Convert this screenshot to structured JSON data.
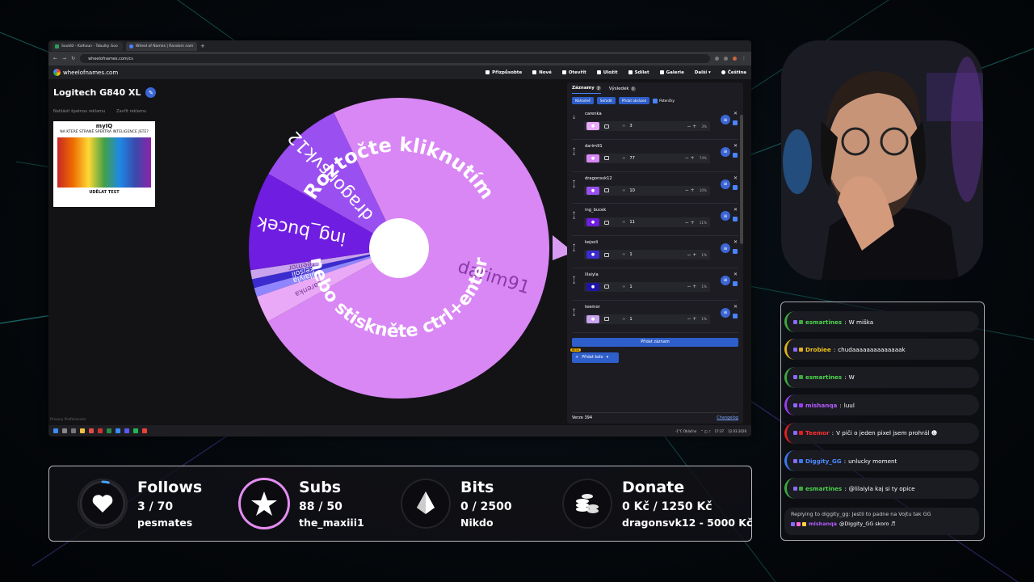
{
  "browser": {
    "tabs": [
      {
        "label": "Soutěž - Kalhoun - Tabulky Goo"
      },
      {
        "label": "Wheel of Names | Random nam"
      }
    ],
    "url": "wheelofnames.com/cs"
  },
  "app": {
    "logo": "wheelofnames.com",
    "menu": [
      "Přizpůsobte",
      "Nové",
      "Otevřít",
      "Uložit",
      "Sdílet",
      "Galerie",
      "Další",
      "Čeština"
    ]
  },
  "wheel": {
    "title": "Logitech G840 XL",
    "ad_links": [
      "Nahlásit špatnou reklamu",
      "Zavřít reklamu"
    ],
    "overlay_line1": "Roztočte kliknutím",
    "overlay_line2": "nebo stiskněte ctrl+enter",
    "slices": [
      {
        "name": "darim91",
        "weight": 77,
        "color": "#d987f5",
        "text": "#8a3aa8"
      },
      {
        "name": "carenka",
        "weight": 3,
        "color": "#e9a9f7",
        "text": "#7a3a98"
      },
      {
        "name": "lilaiyla",
        "weight": 1,
        "color": "#8f86ff",
        "text": "#ffffff"
      },
      {
        "name": "kejsoli",
        "weight": 1,
        "color": "#3a2ccf",
        "text": "#ffffff"
      },
      {
        "name": "teemor",
        "weight": 1,
        "color": "#c9a3ee",
        "text": "#6a3a98"
      },
      {
        "name": "ing_bucek",
        "weight": 11,
        "color": "#6f1de0",
        "text": "#ffffff"
      },
      {
        "name": "dragonsvk12",
        "weight": 10,
        "color": "#9a4ff0",
        "text": "#ffffff"
      }
    ]
  },
  "ad": {
    "brand": "myIQ",
    "question": "NA KTERÉ STRANĚ SPEKTRA INTELIGENCE JSTE?",
    "cta": "UDĚLAT TEST"
  },
  "privacy": "Privacy Preferences",
  "sidebar": {
    "tabs": [
      {
        "label": "Záznamy",
        "count": "7"
      },
      {
        "label": "Výsledek",
        "count": "0"
      }
    ],
    "tools": [
      "Náhodně",
      "Seřadit",
      "Přidat obrázek"
    ],
    "weights_label": "Potenčky",
    "entries": [
      {
        "name": "carenka",
        "weight": "3",
        "pct": "3%",
        "color": "#e9a9f7"
      },
      {
        "name": "darim91",
        "weight": "77",
        "pct": "74%",
        "color": "#d987f5"
      },
      {
        "name": "dragonsvk12",
        "weight": "10",
        "pct": "10%",
        "color": "#9a4ff0"
      },
      {
        "name": "ing_bucek",
        "weight": "11",
        "pct": "11%",
        "color": "#6f1de0"
      },
      {
        "name": "kejsoli",
        "weight": "1",
        "pct": "1%",
        "color": "#3a2ccf"
      },
      {
        "name": "lilaiyla",
        "weight": "1",
        "pct": "1%",
        "color": "#1e15a8"
      },
      {
        "name": "teemor",
        "weight": "1",
        "pct": "1%",
        "color": "#c9a3ee"
      }
    ],
    "add_entry": "Přidat záznam",
    "add_wheel": "Přidat kolo",
    "beta": "BETA",
    "version": "Verze 394",
    "changelog": "Changelog"
  },
  "taskbar": {
    "weather": "-1°C Oblačno",
    "time": "17:37",
    "date": "12.03.2026"
  },
  "chat": {
    "messages": [
      {
        "user": "esmartines",
        "text": "W miška",
        "user_color": "#4cd34c",
        "border": "#3ea83e"
      },
      {
        "user": "Drobiee",
        "text": "chudaaaaaaaaaaaaaak",
        "user_color": "#f0c419",
        "border": "#e0b020"
      },
      {
        "user": "esmartines",
        "text": "W",
        "user_color": "#4cd34c",
        "border": "#3ea83e"
      },
      {
        "user": "mishanqa",
        "text": "luul",
        "user_color": "#b45cff",
        "border": "#9b3cf0"
      },
      {
        "user": "Teemor",
        "text": "V piči o jeden pixel jsem prohrál ☻",
        "user_color": "#ff3030",
        "border": "#e02020"
      },
      {
        "user": "Diggity_GG",
        "text": "unlucky moment",
        "user_color": "#4a8aff",
        "border": "#3a7af0"
      },
      {
        "user": "esmartines",
        "text": "@lilaiyla kaj si ty opice",
        "user_color": "#4cd34c",
        "border": "#3ea83e"
      }
    ],
    "reply": {
      "line": "Replying to diggity_gg: Jestli to padne na Vojtu tak GG",
      "user": "mishanqa",
      "text": "@Diggity_GG skoro ♬",
      "user_color": "#b45cff"
    }
  },
  "stats": {
    "follows": {
      "title": "Follows",
      "value": "3 / 70",
      "user": "pesmates"
    },
    "subs": {
      "title": "Subs",
      "value": "88 / 50",
      "user": "the_maxiii1"
    },
    "bits": {
      "title": "Bits",
      "value": "0 / 2500",
      "user": "Nikdo"
    },
    "donate": {
      "title": "Donate",
      "value": "0 Kč / 1250 Kč",
      "user": "dragonsvk12 - 5000 Kč"
    }
  },
  "colors": {
    "accent": "#2e5ec9",
    "wheel_purple": "#d987f5",
    "subs_ring": "#e58cf2"
  }
}
